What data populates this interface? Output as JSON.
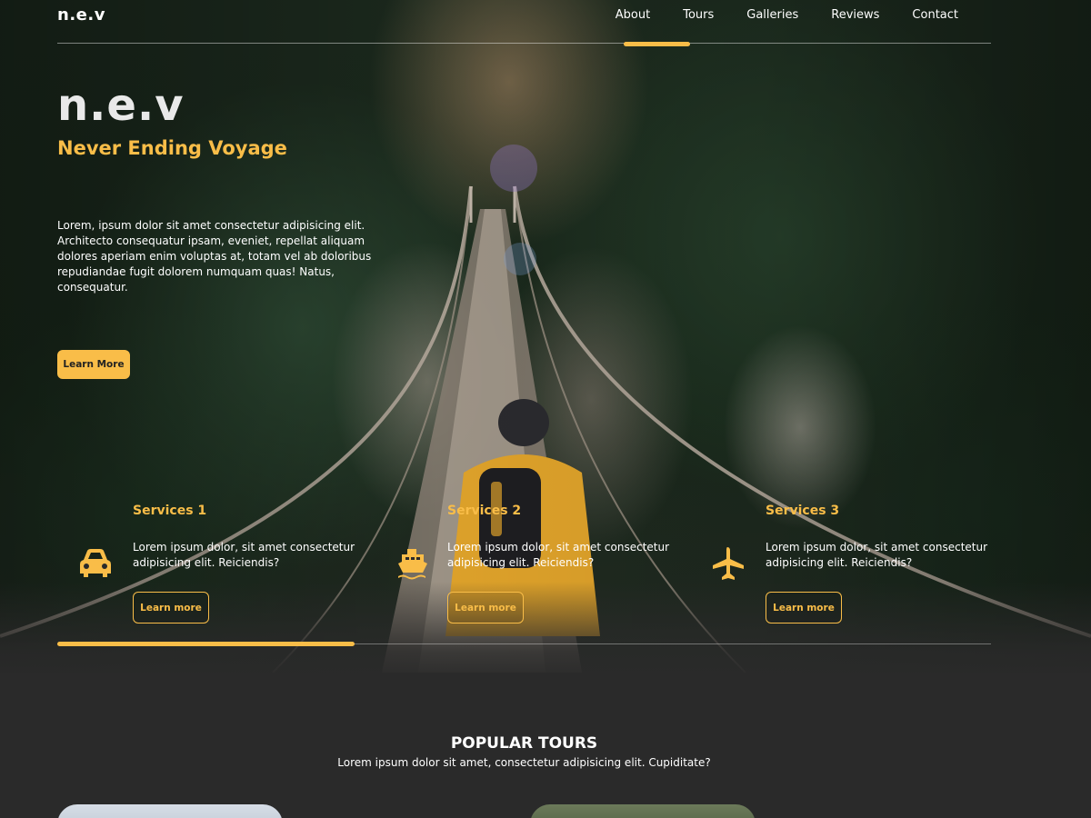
{
  "nav": {
    "brand": "n.e.v",
    "links": [
      "About",
      "Tours",
      "Galleries",
      "Reviews",
      "Contact"
    ],
    "active": "About"
  },
  "hero": {
    "title": "n.e.v",
    "subtitle": "Never Ending Voyage",
    "description": "Lorem, ipsum dolor sit amet consectetur adipisicing elit. Architecto consequatur ipsam, eveniet, repellat aliquam dolores aperiam enim voluptas at, totam vel ab doloribus repudiandae fugit dolorem numquam quas! Natus, consequatur.",
    "cta_label": "Learn More"
  },
  "services": [
    {
      "title": "Services 1",
      "icon": "car-icon",
      "text": "Lorem ipsum dolor, sit amet consectetur adipisicing elit. Reiciendis?",
      "button": "Learn more"
    },
    {
      "title": "Services 2",
      "icon": "ship-icon",
      "text": "Lorem ipsum dolor, sit amet consectetur adipisicing elit. Reiciendis?",
      "button": "Learn more"
    },
    {
      "title": "Services 3",
      "icon": "plane-icon",
      "text": "Lorem ipsum dolor, sit amet consectetur adipisicing elit. Reiciendis?",
      "button": "Learn more"
    }
  ],
  "slider": {
    "progress": 0.318
  },
  "tours": {
    "title": "POPULAR TOURS",
    "subtitle": "Lorem ipsum dolor sit amet, consectetur adipisicing elit. Cupiditate?"
  },
  "colors": {
    "accent": "#f9bd48",
    "background": "#2a2a2a"
  }
}
